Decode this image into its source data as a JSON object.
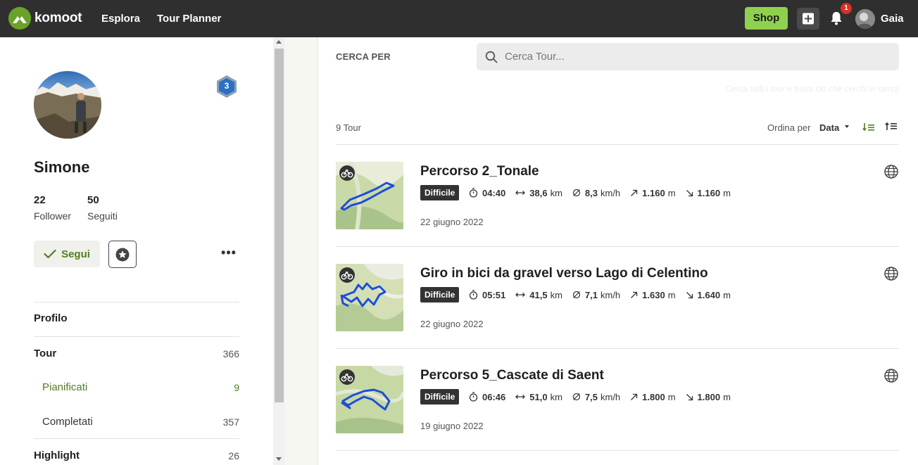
{
  "topbar": {
    "logo": "komoot",
    "nav": [
      "Esplora",
      "Tour Planner"
    ],
    "shop_label": "Shop",
    "notifications_count": "1",
    "user_name": "Gaia"
  },
  "profile": {
    "name": "Simone",
    "level": "3",
    "followers_count": "22",
    "followers_label": "Follower",
    "following_count": "50",
    "following_label": "Seguiti",
    "follow_label": "Segui",
    "more_label": "•••"
  },
  "sidebar": {
    "menu": [
      {
        "label": "Profilo",
        "count": ""
      },
      {
        "label": "Tour",
        "count": "366"
      },
      {
        "label": "Pianificati",
        "count": "9"
      },
      {
        "label": "Completati",
        "count": "357"
      },
      {
        "label": "Highlight",
        "count": "26"
      }
    ]
  },
  "search": {
    "label": "CERCA PER",
    "placeholder": "Cerca Tour...",
    "hint": "Cerca tutti i tour e trova ciò che cerchi in cerca"
  },
  "list": {
    "count_label": "9 Tour",
    "sort_label": "Ordina per",
    "sort_value": "Data"
  },
  "tours": [
    {
      "title": "Percorso 2_Tonale",
      "difficulty": "Difficile",
      "duration": "04:40",
      "distance": "38,6",
      "distance_unit": "km",
      "speed": "8,3",
      "speed_unit": "km/h",
      "up": "1.160",
      "up_unit": "m",
      "down": "1.160",
      "down_unit": "m",
      "date": "22 giugno 2022"
    },
    {
      "title": "Giro in bici da gravel verso Lago di Celentino",
      "difficulty": "Difficile",
      "duration": "05:51",
      "distance": "41,5",
      "distance_unit": "km",
      "speed": "7,1",
      "speed_unit": "km/h",
      "up": "1.630",
      "up_unit": "m",
      "down": "1.640",
      "down_unit": "m",
      "date": "22 giugno 2022"
    },
    {
      "title": "Percorso 5_Cascate di Saent",
      "difficulty": "Difficile",
      "duration": "06:46",
      "distance": "51,0",
      "distance_unit": "km",
      "speed": "7,5",
      "speed_unit": "km/h",
      "up": "1.800",
      "up_unit": "m",
      "down": "1.800",
      "down_unit": "m",
      "date": "19 giugno 2022"
    }
  ],
  "colors": {
    "brand_green": "#6aa127",
    "shop_green": "#8fd14f",
    "topbar_bg": "#2f2f2f",
    "active_green": "#4f7e22",
    "route_blue": "#1d4ed8"
  }
}
